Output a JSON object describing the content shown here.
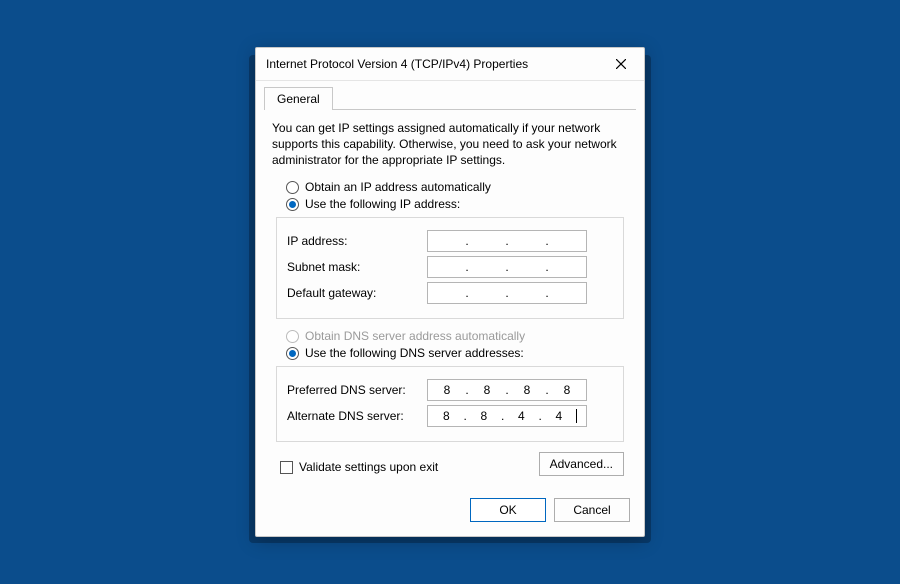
{
  "window": {
    "title": "Internet Protocol Version 4 (TCP/IPv4) Properties"
  },
  "tabs": {
    "general": "General"
  },
  "info_text": "You can get IP settings assigned automatically if your network supports this capability. Otherwise, you need to ask your network administrator for the appropriate IP settings.",
  "ip_section": {
    "auto_label": "Obtain an IP address automatically",
    "manual_label": "Use the following IP address:",
    "ip_address_label": "IP address:",
    "subnet_label": "Subnet mask:",
    "gateway_label": "Default gateway:",
    "ip_address": [
      "",
      "",
      "",
      ""
    ],
    "subnet_mask": [
      "",
      "",
      "",
      ""
    ],
    "default_gateway": [
      "",
      "",
      "",
      ""
    ]
  },
  "dns_section": {
    "auto_label": "Obtain DNS server address automatically",
    "manual_label": "Use the following DNS server addresses:",
    "preferred_label": "Preferred DNS server:",
    "alternate_label": "Alternate DNS server:",
    "preferred_dns": [
      "8",
      "8",
      "8",
      "8"
    ],
    "alternate_dns": [
      "8",
      "8",
      "4",
      "4"
    ]
  },
  "validate_label": "Validate settings upon exit",
  "buttons": {
    "advanced": "Advanced...",
    "ok": "OK",
    "cancel": "Cancel"
  }
}
